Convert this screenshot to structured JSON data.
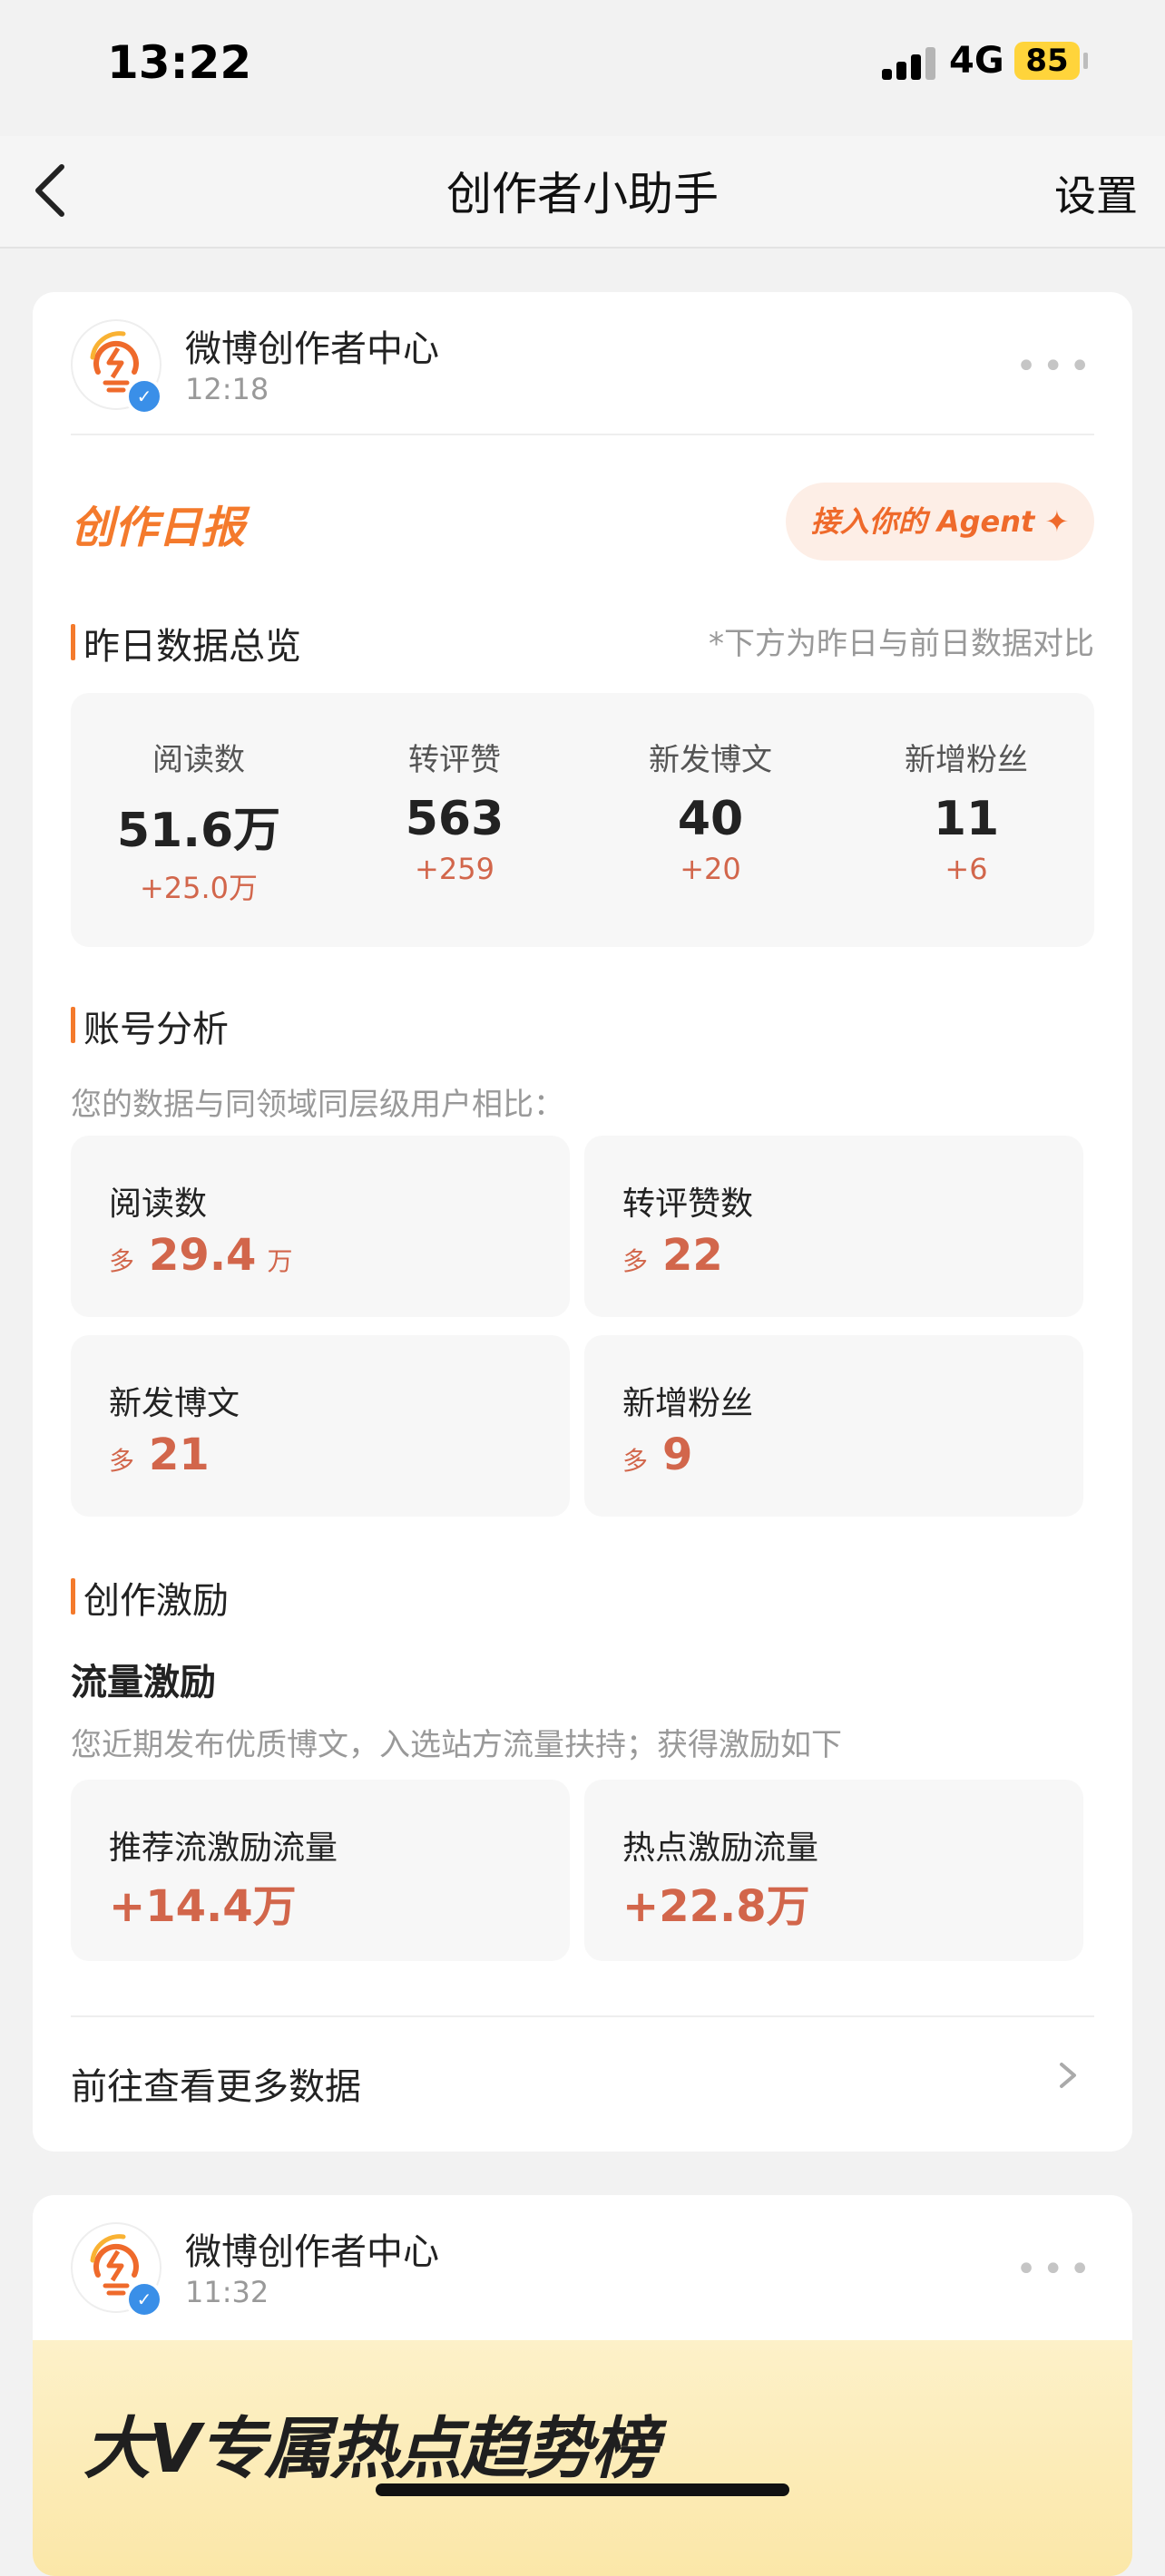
{
  "status": {
    "time": "13:22",
    "network": "4G",
    "battery": "85"
  },
  "nav": {
    "title": "创作者小助手",
    "settings": "设置"
  },
  "message1": {
    "sender": "微博创作者中心",
    "time": "12:18",
    "report_title": "创作日报",
    "agent_button": "接入你的 Agent ✦",
    "overview": {
      "title": "昨日数据总览",
      "note": "*下方为昨日与前日数据对比",
      "stats": [
        {
          "label": "阅读数",
          "value": "51.6万",
          "delta": "+25.0万"
        },
        {
          "label": "转评赞",
          "value": "563",
          "delta": "+259"
        },
        {
          "label": "新发博文",
          "value": "40",
          "delta": "+20"
        },
        {
          "label": "新增粉丝",
          "value": "11",
          "delta": "+6"
        }
      ]
    },
    "analysis": {
      "title": "账号分析",
      "note": "您的数据与同领域同层级用户相比：",
      "items": [
        {
          "label": "阅读数",
          "prefix": "多",
          "value": "29.4",
          "unit": "万"
        },
        {
          "label": "转评赞数",
          "prefix": "多",
          "value": "22",
          "unit": ""
        },
        {
          "label": "新发博文",
          "prefix": "多",
          "value": "21",
          "unit": ""
        },
        {
          "label": "新增粉丝",
          "prefix": "多",
          "value": "9",
          "unit": ""
        }
      ]
    },
    "incentive": {
      "title": "创作激励",
      "subtitle": "流量激励",
      "note": "您近期发布优质博文，入选站方流量扶持；获得激励如下",
      "items": [
        {
          "label": "推荐流激励流量",
          "value": "+14.4万"
        },
        {
          "label": "热点激励流量",
          "value": "+22.8万"
        }
      ]
    },
    "more_link": "前往查看更多数据"
  },
  "message2": {
    "sender": "微博创作者中心",
    "time": "11:32",
    "banner": "大V专属热点趋势榜"
  },
  "colors": {
    "accent": "#f47a2c",
    "value_red": "#d2664b",
    "verified_blue": "#3a8fe8"
  }
}
